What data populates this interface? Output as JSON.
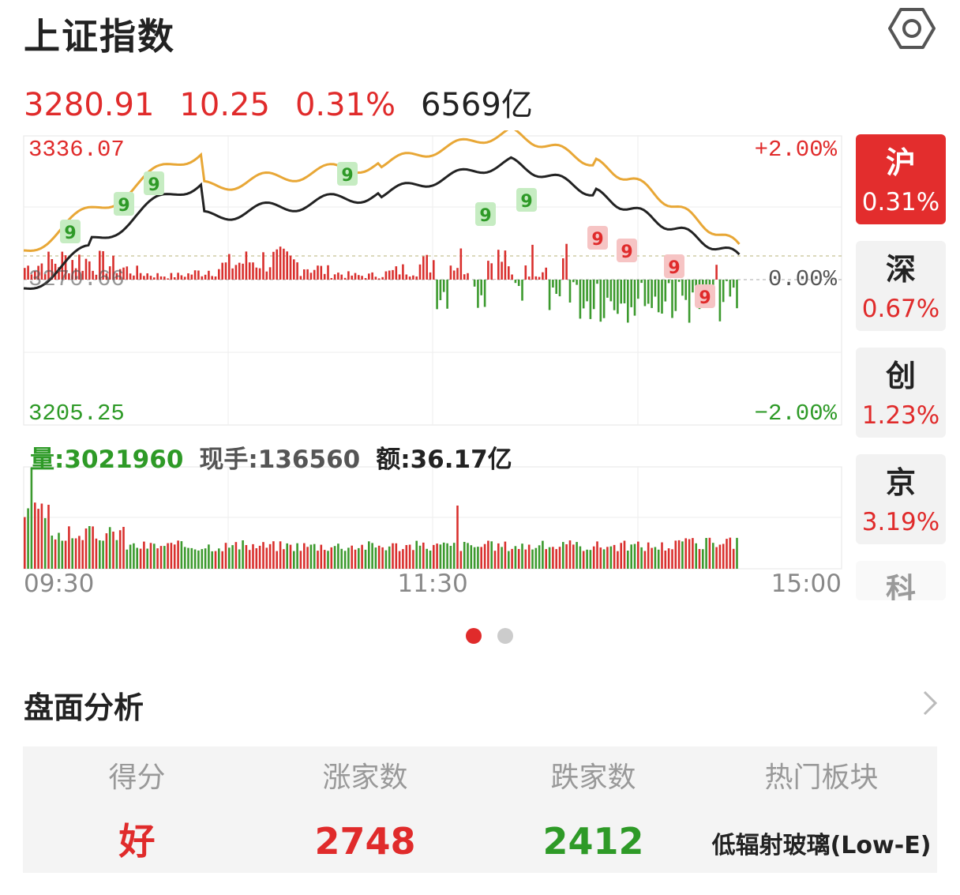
{
  "header": {
    "title": "上证指数",
    "settings_icon": "hexagon-gear-icon"
  },
  "quote": {
    "price": "3280.91",
    "change": "10.25",
    "change_pct": "0.31%",
    "turnover": "6569亿"
  },
  "colors": {
    "up": "#e02b2b",
    "down": "#2e9a27",
    "avg_line": "#e8a736",
    "price_line": "#222222"
  },
  "chart": {
    "y_high": "3336.07",
    "y_ref": "3270.66",
    "y_low": "3205.25",
    "pct_high": "+2.00%",
    "pct_ref": "0.00%",
    "pct_low": "−2.00%",
    "x_labels": [
      "09:30",
      "11:30",
      "15:00"
    ],
    "nine_marker_label": "9"
  },
  "volume": {
    "label_vol": "量:3021960",
    "label_now": "现手:136560",
    "label_amt": "额:36.17亿"
  },
  "market_tabs": [
    {
      "name": "沪",
      "pct": "0.31%"
    },
    {
      "name": "深",
      "pct": "0.67%"
    },
    {
      "name": "创",
      "pct": "1.23%"
    },
    {
      "name": "京",
      "pct": "3.19%"
    },
    {
      "name": "科",
      "pct": ""
    }
  ],
  "pager": {
    "count": 2,
    "active": 0
  },
  "analysis": {
    "title": "盘面分析",
    "columns": [
      {
        "header": "得分",
        "value": "好"
      },
      {
        "header": "涨家数",
        "value": "2748"
      },
      {
        "header": "跌家数",
        "value": "2412"
      },
      {
        "header": "热门板块",
        "value": "低辐射玻璃(Low-E)"
      }
    ]
  }
}
